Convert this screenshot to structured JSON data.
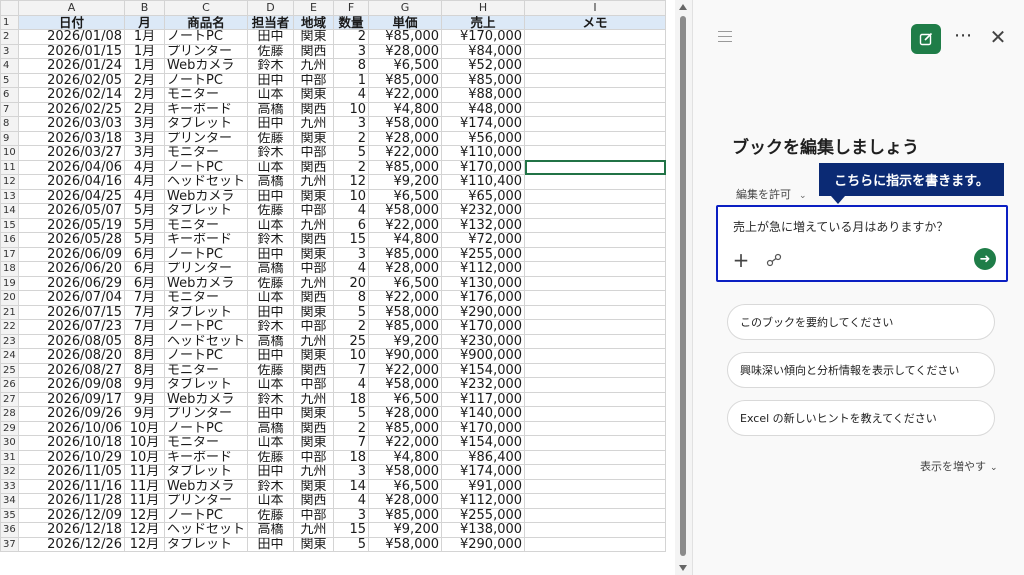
{
  "columns": [
    "A",
    "B",
    "C",
    "D",
    "E",
    "F",
    "G",
    "H",
    "I"
  ],
  "headers": [
    "日付",
    "月",
    "商品名",
    "担当者",
    "地域",
    "数量",
    "単価",
    "売上",
    "メモ"
  ],
  "rows": [
    [
      "2026/01/08",
      "1月",
      "ノートPC",
      "田中",
      "関東",
      "2",
      "¥85,000",
      "¥170,000"
    ],
    [
      "2026/01/15",
      "1月",
      "プリンター",
      "佐藤",
      "関西",
      "3",
      "¥28,000",
      "¥84,000"
    ],
    [
      "2026/01/24",
      "1月",
      "Webカメラ",
      "鈴木",
      "九州",
      "8",
      "¥6,500",
      "¥52,000"
    ],
    [
      "2026/02/05",
      "2月",
      "ノートPC",
      "田中",
      "中部",
      "1",
      "¥85,000",
      "¥85,000"
    ],
    [
      "2026/02/14",
      "2月",
      "モニター",
      "山本",
      "関東",
      "4",
      "¥22,000",
      "¥88,000"
    ],
    [
      "2026/02/25",
      "2月",
      "キーボード",
      "高橋",
      "関西",
      "10",
      "¥4,800",
      "¥48,000"
    ],
    [
      "2026/03/03",
      "3月",
      "タブレット",
      "田中",
      "九州",
      "3",
      "¥58,000",
      "¥174,000"
    ],
    [
      "2026/03/18",
      "3月",
      "プリンター",
      "佐藤",
      "関東",
      "2",
      "¥28,000",
      "¥56,000"
    ],
    [
      "2026/03/27",
      "3月",
      "モニター",
      "鈴木",
      "中部",
      "5",
      "¥22,000",
      "¥110,000"
    ],
    [
      "2026/04/06",
      "4月",
      "ノートPC",
      "山本",
      "関西",
      "2",
      "¥85,000",
      "¥170,000"
    ],
    [
      "2026/04/16",
      "4月",
      "ヘッドセット",
      "高橋",
      "九州",
      "12",
      "¥9,200",
      "¥110,400"
    ],
    [
      "2026/04/25",
      "4月",
      "Webカメラ",
      "田中",
      "関東",
      "10",
      "¥6,500",
      "¥65,000"
    ],
    [
      "2026/05/07",
      "5月",
      "タブレット",
      "佐藤",
      "中部",
      "4",
      "¥58,000",
      "¥232,000"
    ],
    [
      "2026/05/19",
      "5月",
      "モニター",
      "山本",
      "九州",
      "6",
      "¥22,000",
      "¥132,000"
    ],
    [
      "2026/05/28",
      "5月",
      "キーボード",
      "鈴木",
      "関西",
      "15",
      "¥4,800",
      "¥72,000"
    ],
    [
      "2026/06/09",
      "6月",
      "ノートPC",
      "田中",
      "関東",
      "3",
      "¥85,000",
      "¥255,000"
    ],
    [
      "2026/06/20",
      "6月",
      "プリンター",
      "高橋",
      "中部",
      "4",
      "¥28,000",
      "¥112,000"
    ],
    [
      "2026/06/29",
      "6月",
      "Webカメラ",
      "佐藤",
      "九州",
      "20",
      "¥6,500",
      "¥130,000"
    ],
    [
      "2026/07/04",
      "7月",
      "モニター",
      "山本",
      "関西",
      "8",
      "¥22,000",
      "¥176,000"
    ],
    [
      "2026/07/15",
      "7月",
      "タブレット",
      "田中",
      "関東",
      "5",
      "¥58,000",
      "¥290,000"
    ],
    [
      "2026/07/23",
      "7月",
      "ノートPC",
      "鈴木",
      "中部",
      "2",
      "¥85,000",
      "¥170,000"
    ],
    [
      "2026/08/05",
      "8月",
      "ヘッドセット",
      "高橋",
      "九州",
      "25",
      "¥9,200",
      "¥230,000"
    ],
    [
      "2026/08/20",
      "8月",
      "ノートPC",
      "田中",
      "関東",
      "10",
      "¥90,000",
      "¥900,000"
    ],
    [
      "2026/08/27",
      "8月",
      "モニター",
      "佐藤",
      "関西",
      "7",
      "¥22,000",
      "¥154,000"
    ],
    [
      "2026/09/08",
      "9月",
      "タブレット",
      "山本",
      "中部",
      "4",
      "¥58,000",
      "¥232,000"
    ],
    [
      "2026/09/17",
      "9月",
      "Webカメラ",
      "鈴木",
      "九州",
      "18",
      "¥6,500",
      "¥117,000"
    ],
    [
      "2026/09/26",
      "9月",
      "プリンター",
      "田中",
      "関東",
      "5",
      "¥28,000",
      "¥140,000"
    ],
    [
      "2026/10/06",
      "10月",
      "ノートPC",
      "高橋",
      "関西",
      "2",
      "¥85,000",
      "¥170,000"
    ],
    [
      "2026/10/18",
      "10月",
      "モニター",
      "山本",
      "関東",
      "7",
      "¥22,000",
      "¥154,000"
    ],
    [
      "2026/10/29",
      "10月",
      "キーボード",
      "佐藤",
      "中部",
      "18",
      "¥4,800",
      "¥86,400"
    ],
    [
      "2026/11/05",
      "11月",
      "タブレット",
      "田中",
      "九州",
      "3",
      "¥58,000",
      "¥174,000"
    ],
    [
      "2026/11/16",
      "11月",
      "Webカメラ",
      "鈴木",
      "関東",
      "14",
      "¥6,500",
      "¥91,000"
    ],
    [
      "2026/11/28",
      "11月",
      "プリンター",
      "山本",
      "関西",
      "4",
      "¥28,000",
      "¥112,000"
    ],
    [
      "2026/12/09",
      "12月",
      "ノートPC",
      "佐藤",
      "中部",
      "3",
      "¥85,000",
      "¥255,000"
    ],
    [
      "2026/12/18",
      "12月",
      "ヘッドセット",
      "高橋",
      "九州",
      "15",
      "¥9,200",
      "¥138,000"
    ],
    [
      "2026/12/26",
      "12月",
      "タブレット",
      "田中",
      "関東",
      "5",
      "¥58,000",
      "¥290,000"
    ]
  ],
  "selected_row": 11,
  "pane": {
    "title": "ブックを編集しましょう",
    "allow_label": "編集を許可",
    "tooltip": "こちらに指示を書きます。",
    "prompt_text": "売上が急に増えている月はありますか？",
    "suggestions": [
      "このブックを要約してください",
      "興味深い傾向と分析情報を表示してください",
      "Excel の新しいヒントを教えてください"
    ],
    "show_more": "表示を増やす"
  },
  "icons": {
    "menu": "hamburger-icon",
    "new_chat": "edit-icon",
    "more": "more-icon",
    "close": "close-icon",
    "add": "plus-icon",
    "attach": "link-icon",
    "send": "arrow-right-icon"
  },
  "colors": {
    "accent": "#1f7d48",
    "tooltip_bg": "#0b2a74",
    "prompt_border": "#0b1fc2",
    "header_fill": "#dce9f7"
  }
}
